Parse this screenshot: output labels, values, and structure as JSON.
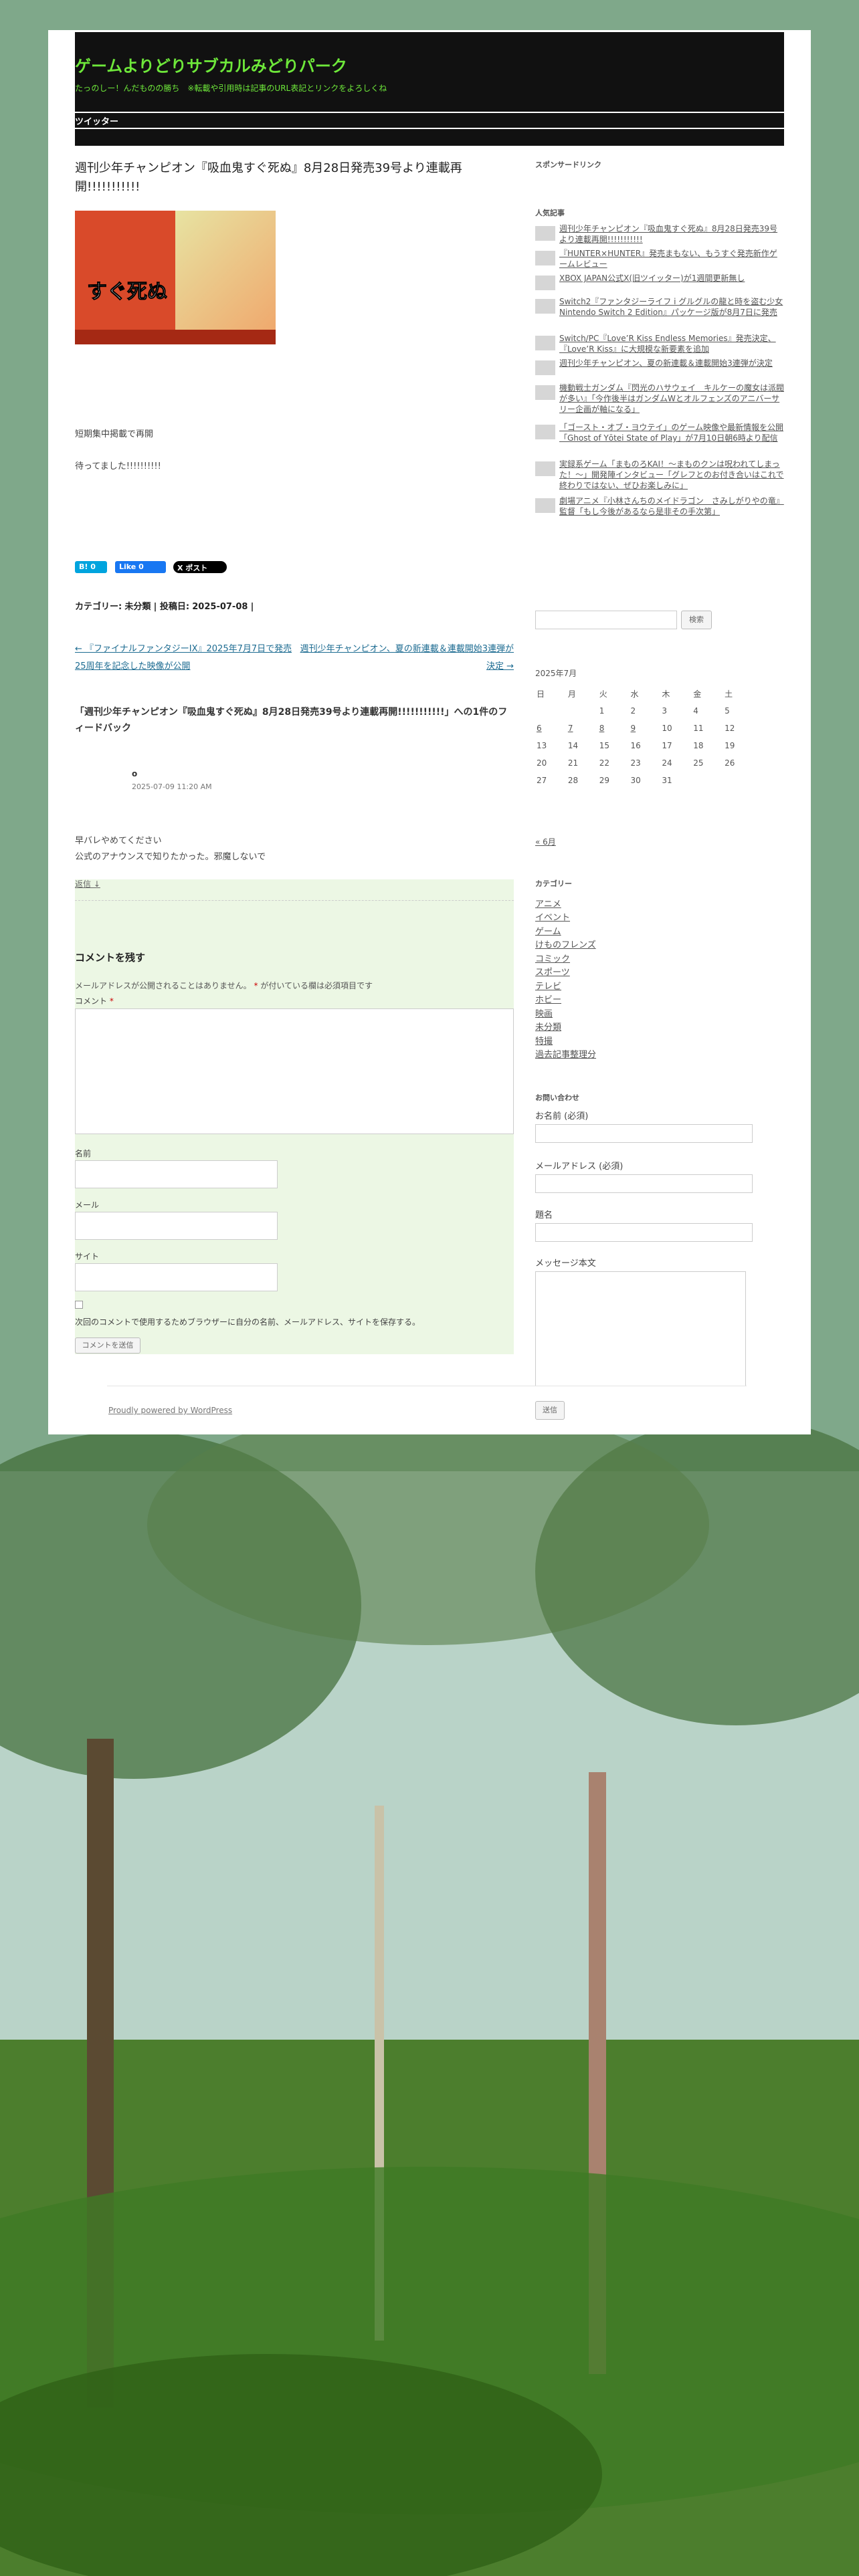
{
  "site": {
    "title": "ゲームよりどりサブカルみどりパーク",
    "description": "たっのしー！んだものの勝ち　※転載や引用時は記事のURL表記とリンクをよろしくね",
    "nav": [
      "ツイッター"
    ]
  },
  "post": {
    "title": "週刊少年チャンピオン『吸血鬼すぐ死ぬ』8月28日発売39号より連載再開!!!!!!!!!!!",
    "image_alt_text": "すぐ死ぬ",
    "paragraphs": [
      "短期集中掲載で再開",
      "待ってました!!!!!!!!!!"
    ],
    "share": {
      "hatena": "B! 0",
      "facebook": "Like 0",
      "x": "X ポスト"
    },
    "meta": {
      "category_label": "カテゴリー:",
      "category": "未分類",
      "posted_label": "| 投稿日:",
      "date": "2025-07-08",
      "suffix": "|"
    },
    "prev": "← 『ファイナルファンタジーIX』2025年7月7日で発売25周年を記念した映像が公開",
    "next": "週刊少年チャンピオン、夏の新連載＆連載開始3連弾が決定 →"
  },
  "comments": {
    "title": "「週刊少年チャンピオン『吸血鬼すぐ死ぬ』8月28日発売39号より連載再開!!!!!!!!!!!」への1件のフィードバック",
    "items": [
      {
        "author": "o",
        "date": "2025-07-09 11:20 AM",
        "body_lines": [
          "早バレやめてください",
          "公式のアナウンスで知りたかった。邪魔しないで"
        ]
      }
    ],
    "reply": "返信 ↓"
  },
  "reply_form": {
    "title": "コメントを残す",
    "notes_a": "メールアドレスが公開されることはありません。",
    "req_mark": "*",
    "notes_b": "が付いている欄は必須項目です",
    "comment_label": "コメント",
    "name_label": "名前",
    "email_label": "メール",
    "site_label": "サイト",
    "cookie_label": "次回のコメントで使用するためブラウザーに自分の名前、メールアドレス、サイトを保存する。",
    "submit": "コメントを送信"
  },
  "sidebar": {
    "sponsored": "スポンサードリンク",
    "popular_title": "人気記事",
    "popular": [
      "週刊少年チャンピオン『吸血鬼すぐ死ぬ』8月28日発売39号より連載再開!!!!!!!!!!!",
      "『HUNTER×HUNTER』発売まもない、もうすぐ発売新作ゲームレビュー",
      "XBOX JAPAN公式X(旧ツイッター)が1週間更新無し",
      "Switch2『ファンタジーライフ i グルグルの龍と時を盗む少女 Nintendo Switch 2 Edition』パッケージ版が8月7日に発売",
      "Switch/PC『Love’R Kiss Endless Memories』発売決定、『Love’R Kiss』に大規模な新要素を追加",
      "週刊少年チャンピオン、夏の新連載＆連載開始3連弾が決定",
      "機動戦士ガンダム『閃光のハサウェイ　キルケーの魔女は派閥が多い』「今作後半はガンダムWとオルフェンズのアニバーサリー企画が軸になる」",
      "「ゴースト・オブ・ヨウテイ」のゲーム映像や最新情報を公開「Ghost of Yōtei State of Play」が7月10日朝6時より配信",
      "実録系ゲーム「まものろKAI！～まものクンは呪われてしまった！～」開発陣インタビュー「グレフとのお付き合いはこれで終わりではない、ぜひお楽しみに」",
      "劇場アニメ『小林さんちのメイドラゴン　さみしがりやの竜』監督「もし今後があるなら是非その手次第」"
    ],
    "search_button": "検索",
    "calendar": {
      "caption": "2025年7月",
      "days": [
        "日",
        "月",
        "火",
        "水",
        "木",
        "金",
        "土"
      ],
      "rows": [
        [
          "",
          "",
          "1",
          "2",
          "3",
          "4",
          "5"
        ],
        [
          "6",
          "7",
          "8",
          "9",
          "10",
          "11",
          "12"
        ],
        [
          "13",
          "14",
          "15",
          "16",
          "17",
          "18",
          "19"
        ],
        [
          "20",
          "21",
          "22",
          "23",
          "24",
          "25",
          "26"
        ],
        [
          "27",
          "28",
          "29",
          "30",
          "31",
          "",
          ""
        ]
      ],
      "linked": [
        "6",
        "7",
        "8",
        "9"
      ],
      "prev": "« 6月"
    },
    "categories_title": "カテゴリー",
    "categories": [
      "アニメ",
      "イベント",
      "ゲーム",
      "けものフレンズ",
      "コミック",
      "スポーツ",
      "テレビ",
      "ホビー",
      "映画",
      "未分類",
      "特撮",
      "過去記事整理分"
    ],
    "contact": {
      "title": "お問い合わせ",
      "name_label": "お名前 (必須)",
      "email_label": "メールアドレス (必須)",
      "subject_label": "題名",
      "message_label": "メッセージ本文",
      "send": "送信"
    }
  },
  "footer": {
    "credit": "Proudly powered by WordPress"
  }
}
